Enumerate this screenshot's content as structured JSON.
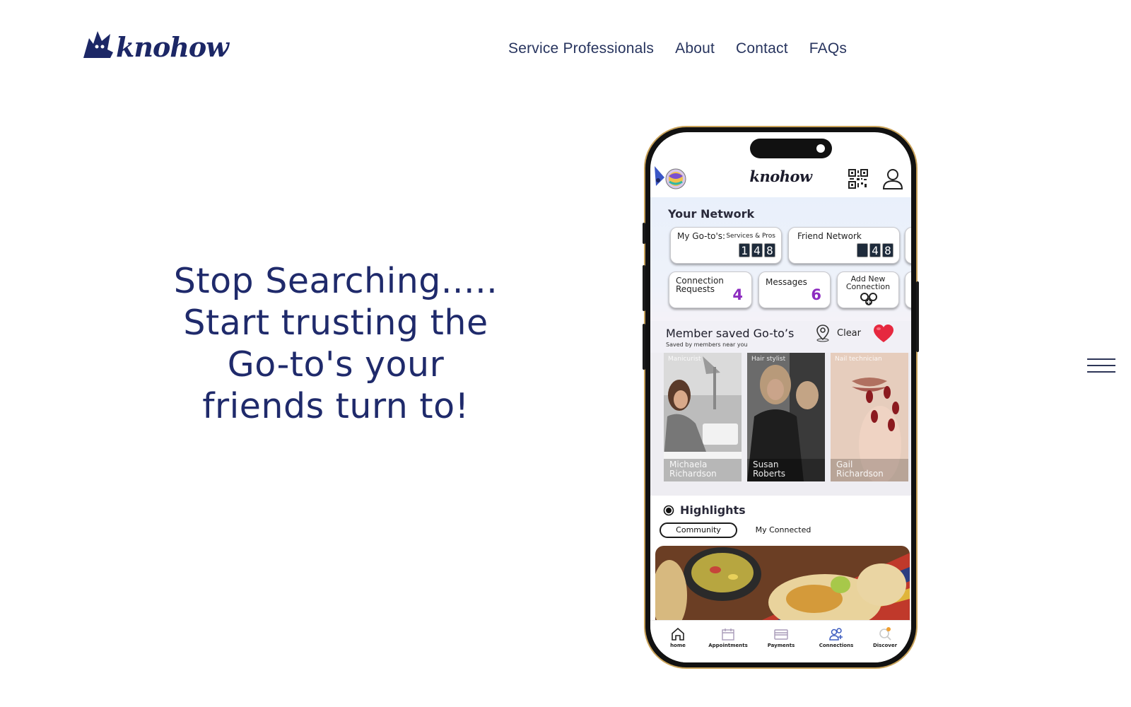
{
  "brand": {
    "name": "knohow"
  },
  "nav": {
    "items": [
      "Service Professionals",
      "About",
      "Contact",
      "FAQs"
    ]
  },
  "hero": {
    "lines": [
      "Stop Searching.....",
      "Start trusting the",
      "Go-to's your",
      "friends turn to!"
    ]
  },
  "phone": {
    "app_logo": "knohow",
    "network": {
      "title": "Your Network",
      "my_gotos": {
        "label": "My Go-to's:",
        "sublabel": "Services & Pros",
        "digits": [
          "1",
          "4",
          "8"
        ]
      },
      "friend_network": {
        "label": "Friend Network",
        "digits": [
          "",
          "4",
          "8"
        ]
      },
      "connection_requests": {
        "label_line1": "Connection",
        "label_line2": "Requests",
        "count": "4"
      },
      "messages": {
        "label": "Messages",
        "count": "6"
      },
      "add_connection": {
        "label_line1": "Add New",
        "label_line2": "Connection"
      }
    },
    "saved": {
      "title": "Member saved Go-to’s",
      "subtitle": "Saved by members near you",
      "clear_label": "Clear",
      "pros": [
        {
          "role": "Manicurist",
          "name_line1": "Michaela",
          "name_line2": "Richardson"
        },
        {
          "role": "Hair stylist",
          "name_line1": "Susan",
          "name_line2": "Roberts"
        },
        {
          "role": "Nail technician",
          "name_line1": "Gail",
          "name_line2": "Richardson"
        }
      ]
    },
    "highlights": {
      "title": "Highlights",
      "tabs": [
        "Community",
        "My Connected"
      ],
      "active_tab": "Community"
    },
    "bottom_nav": [
      "home",
      "Appointments",
      "Payments",
      "Connections",
      "Discover"
    ]
  },
  "colors": {
    "heading": "#1f2a6b",
    "nav_text": "#27345e",
    "count_purple": "#8d2cc0",
    "phone_frame_gold": "#c9a259"
  }
}
